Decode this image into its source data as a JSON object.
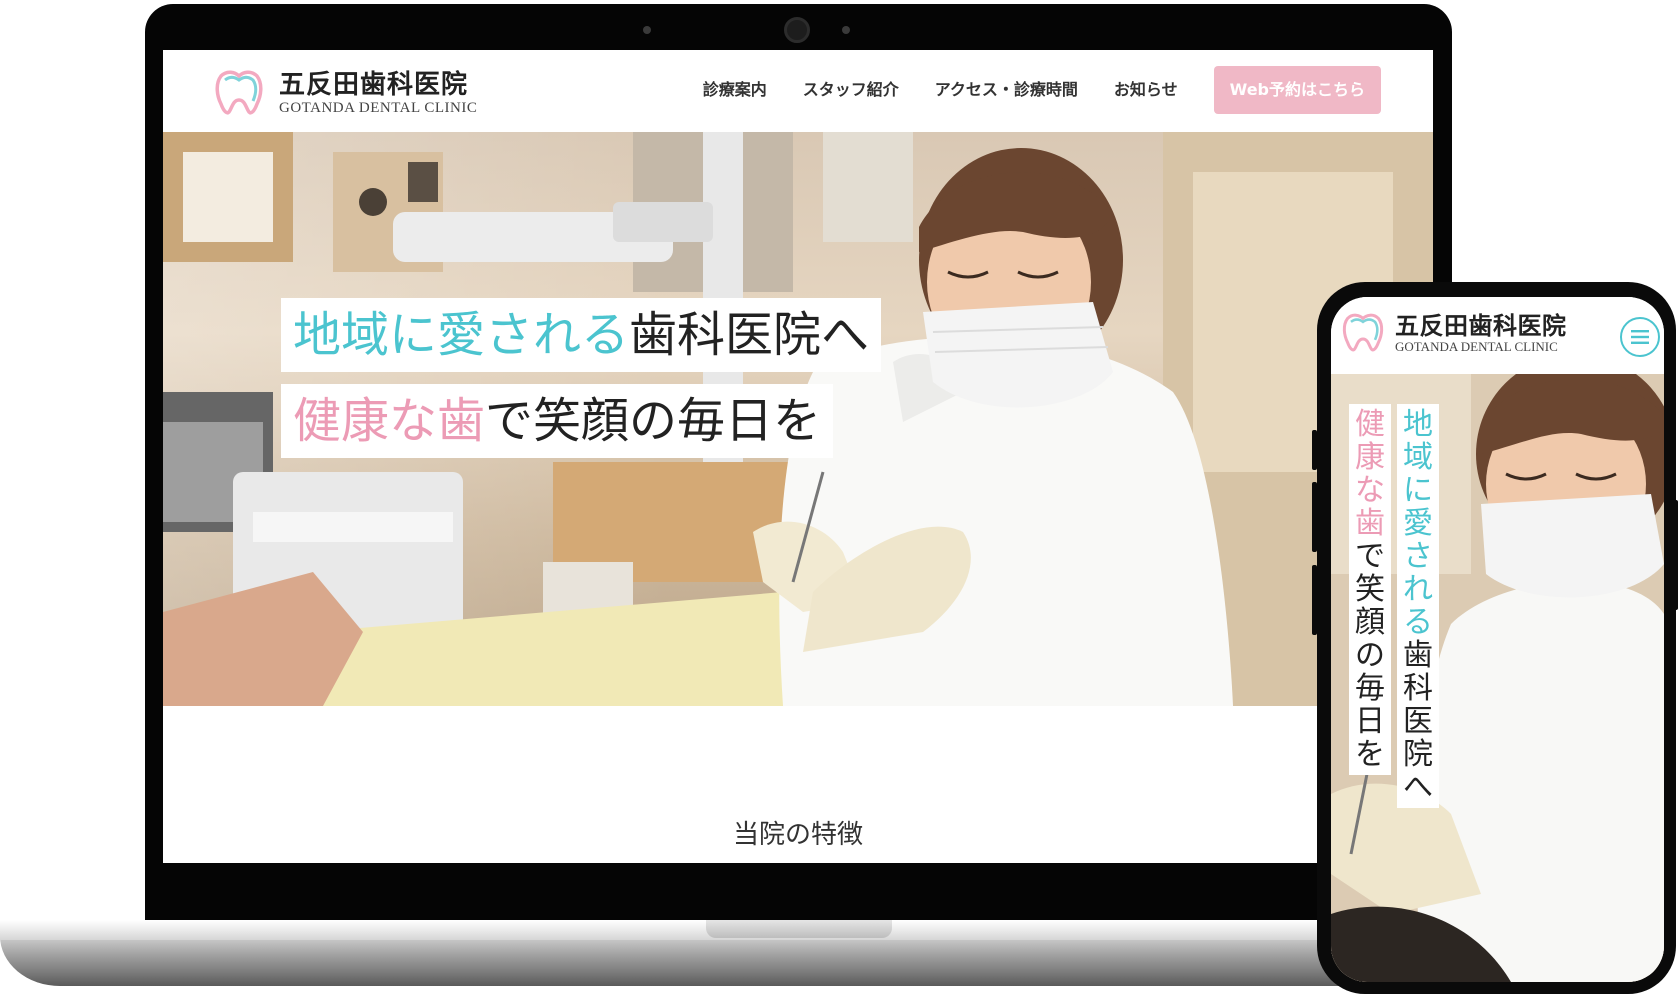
{
  "site": {
    "logo_jp": "五反田歯科医院",
    "logo_en": "GOTANDA DENTAL CLINIC"
  },
  "nav": {
    "items": [
      "診療案内",
      "スタッフ紹介",
      "アクセス・診療時間",
      "お知らせ"
    ],
    "cta_label": "Web予約はこちら"
  },
  "hero": {
    "line1_accent": "地域に愛される",
    "line1_rest": "歯科医院へ",
    "line2_accent": "健康な歯",
    "line2_rest": "で笑顔の毎日を"
  },
  "section": {
    "title": "当院の特徴"
  },
  "colors": {
    "accent_cyan": "#4bc4cf",
    "accent_pink": "#ec9bb5",
    "cta_bg": "#f0b8c6"
  },
  "icons": {
    "logo": "tooth-icon",
    "menu": "hamburger-menu-icon"
  }
}
